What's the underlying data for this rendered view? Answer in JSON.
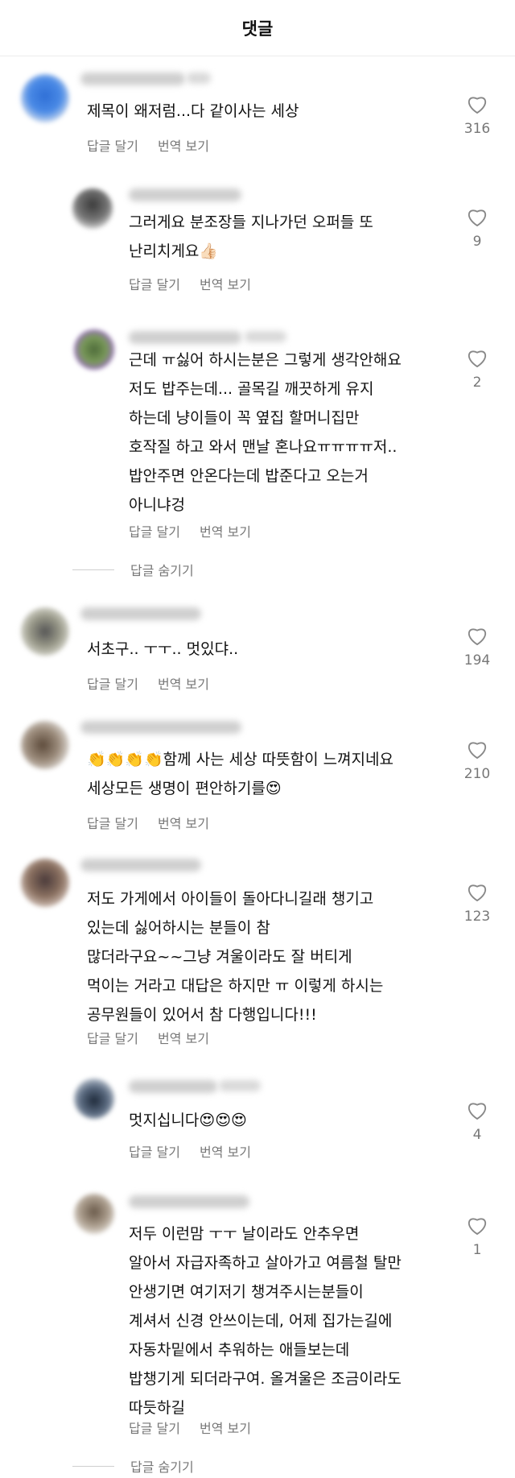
{
  "header": {
    "title": "댓글"
  },
  "actions": {
    "reply": "답글 달기",
    "translate": "번역 보기",
    "hide_replies": "답글 숨기기"
  },
  "comments": [
    {
      "time_hint": "시간",
      "text": "제목이 왜저럼...다 같이사는 세상",
      "likes": "316"
    },
    {
      "text": "그러게요 분조장들 지나가던 오퍼들 또\n난리치게요👍🏻",
      "likes": "9"
    },
    {
      "time_hint": "3시간",
      "text": "근데 ㅠ싫어 하시는분은 그렇게 생각안해요\n저도 밥주는데... 골목길 깨끗하게 유지\n하는데 냥이들이 꼭 옆집 할머니집만\n호작질 하고 와서 맨날 혼나요ㅠㅠㅠㅠ저..\n밥안주면 안온다는데 밥준다고 오는거\n아니냐겅",
      "likes": "2"
    },
    {
      "text": "서초구.. ㅜㅜ.. 멋있댜..",
      "likes": "194"
    },
    {
      "text": "👏👏👏👏함께 사는 세상 따뜻함이 느껴지네요\n세상모든 생명이 편안하기를😍",
      "likes": "210"
    },
    {
      "text": "저도 가게에서 아이들이 돌아다니길래 챙기고\n있는데 싫어하시는 분들이 참\n많더라구요~~그냥 겨울이라도 잘 버티게\n먹이는 거라고 대답은 하지만 ㅠ 이렇게 하시는\n공무원들이 있어서 참 다행입니다!!!",
      "likes": "123"
    },
    {
      "time_hint": "15시간",
      "text": "멋지십니다😍😍😍",
      "likes": "4"
    },
    {
      "text": "저두 이런맘 ㅜㅜ 날이라도 안추우면\n알아서 자급자족하고 살아가고 여름철 탈만\n안생기면 여기저기 챙겨주시는분들이\n계셔서 신경 안쓰이는데, 어제 집가는길에\n자동차밑에서 추워하는 애들보는데\n밥챙기게 되더라구여. 올겨울은 조금이라도\n따듯하길",
      "likes": "1"
    }
  ],
  "colors": {
    "text": "#111111",
    "secondary": "#777777",
    "divider": "#ececec"
  }
}
